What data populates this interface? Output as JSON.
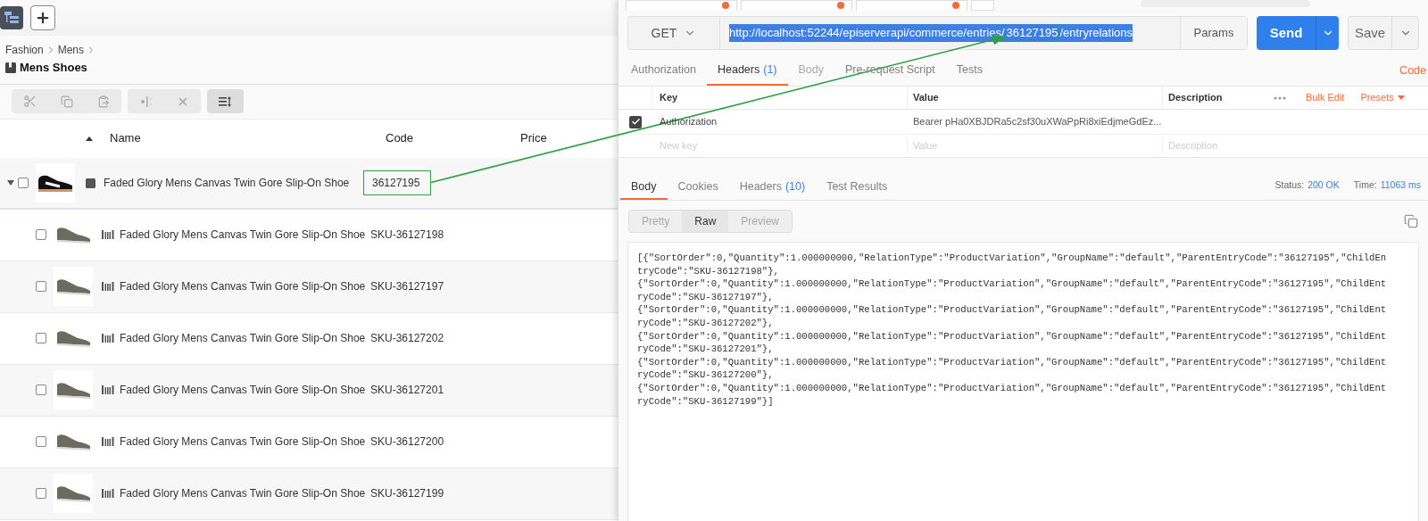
{
  "catalog": {
    "breadcrumb": [
      "Fashion",
      "Mens"
    ],
    "title": "Mens Shoes",
    "columns": [
      "Name",
      "Code",
      "Price"
    ],
    "rows": [
      {
        "kind": "product",
        "expanded": true,
        "checked": false,
        "name": "Faded Glory Mens Canvas Twin Gore Slip-On Shoe",
        "code": "36127195",
        "highlighted": true
      },
      {
        "kind": "variant",
        "checked": false,
        "name": "Faded Glory Mens Canvas Twin Gore Slip-On Shoe",
        "code": "SKU-36127198",
        "highlighted": false
      },
      {
        "kind": "variant",
        "checked": false,
        "name": "Faded Glory Mens Canvas Twin Gore Slip-On Shoe",
        "code": "SKU-36127197",
        "highlighted": false
      },
      {
        "kind": "variant",
        "checked": false,
        "name": "Faded Glory Mens Canvas Twin Gore Slip-On Shoe",
        "code": "SKU-36127202",
        "highlighted": false
      },
      {
        "kind": "variant",
        "checked": false,
        "name": "Faded Glory Mens Canvas Twin Gore Slip-On Shoe",
        "code": "SKU-36127201",
        "highlighted": false
      },
      {
        "kind": "variant",
        "checked": false,
        "name": "Faded Glory Mens Canvas Twin Gore Slip-On Shoe",
        "code": "SKU-36127200",
        "highlighted": false
      },
      {
        "kind": "variant",
        "checked": false,
        "name": "Faded Glory Mens Canvas Twin Gore Slip-On Shoe",
        "code": "SKU-36127199",
        "highlighted": false
      }
    ]
  },
  "request": {
    "method": "GET",
    "url_before": "http://localhost:52244/episerverapi/commerce/entries/",
    "url_highlight": "36127195",
    "url_after": "/entryrelations",
    "params": "Params",
    "send": "Send",
    "save": "Save",
    "tabs": [
      {
        "label": "Authorization",
        "selected": false,
        "disabled": false
      },
      {
        "label": "Headers",
        "count": "(1)",
        "selected": true,
        "disabled": false
      },
      {
        "label": "Body",
        "selected": false,
        "disabled": true
      },
      {
        "label": "Pre-request Script",
        "selected": false,
        "disabled": false
      },
      {
        "label": "Tests",
        "selected": false,
        "disabled": false
      }
    ],
    "code_link": "Code",
    "header_columns": [
      "Key",
      "Value",
      "Description"
    ],
    "bulk_edit": "Bulk Edit",
    "presets": "Presets",
    "headers": [
      {
        "checked": true,
        "key": "Authorization",
        "value": "Bearer pHa0XBJDRa5c2sf30uXWaPpRi8xiEdjmeGdEz..."
      }
    ],
    "new_row": {
      "key": "New key",
      "value": "Value",
      "description": "Description"
    }
  },
  "response": {
    "tabs": [
      {
        "label": "Body",
        "selected": true
      },
      {
        "label": "Cookies",
        "selected": false
      },
      {
        "label": "Headers",
        "count": "(10)",
        "selected": false
      },
      {
        "label": "Test Results",
        "selected": false
      }
    ],
    "status_label": "Status:",
    "status": "200 OK",
    "time_label": "Time:",
    "time": "11063 ms",
    "views": [
      {
        "label": "Pretty",
        "selected": false
      },
      {
        "label": "Raw",
        "selected": true
      },
      {
        "label": "Preview",
        "selected": false
      }
    ],
    "body_lines": [
      "[{\"SortOrder\":0,\"Quantity\":1.000000000,\"RelationType\":\"ProductVariation\",\"GroupName\":\"default\",\"ParentEntryCode\":\"36127195\",\"ChildEn",
      "tryCode\":\"SKU-36127198\"},",
      "{\"SortOrder\":0,\"Quantity\":1.000000000,\"RelationType\":\"ProductVariation\",\"GroupName\":\"default\",\"ParentEntryCode\":\"36127195\",\"ChildEnt",
      "ryCode\":\"SKU-36127197\"},",
      "{\"SortOrder\":0,\"Quantity\":1.000000000,\"RelationType\":\"ProductVariation\",\"GroupName\":\"default\",\"ParentEntryCode\":\"36127195\",\"ChildEnt",
      "ryCode\":\"SKU-36127202\"},",
      "{\"SortOrder\":0,\"Quantity\":1.000000000,\"RelationType\":\"ProductVariation\",\"GroupName\":\"default\",\"ParentEntryCode\":\"36127195\",\"ChildEnt",
      "ryCode\":\"SKU-36127201\"},",
      "{\"SortOrder\":0,\"Quantity\":1.000000000,\"RelationType\":\"ProductVariation\",\"GroupName\":\"default\",\"ParentEntryCode\":\"36127195\",\"ChildEnt",
      "ryCode\":\"SKU-36127200\"},",
      "{\"SortOrder\":0,\"Quantity\":1.000000000,\"RelationType\":\"ProductVariation\",\"GroupName\":\"default\",\"ParentEntryCode\":\"36127195\",\"ChildEnt",
      "ryCode\":\"SKU-36127199\"}]"
    ]
  }
}
